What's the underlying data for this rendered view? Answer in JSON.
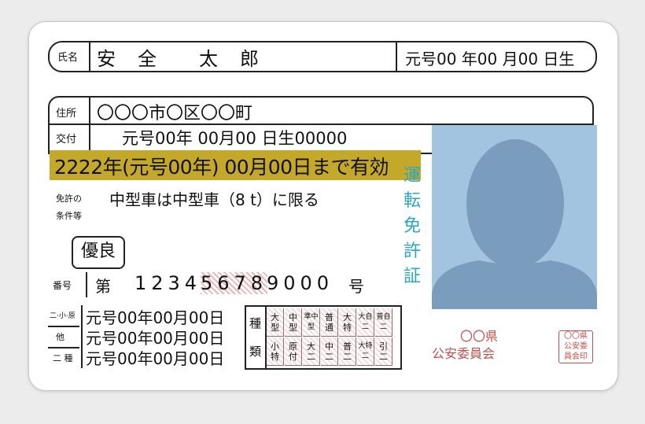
{
  "name": {
    "label": "氏名",
    "value": "安　全　　太　郎",
    "birth": "元号00 年00 月00 日生"
  },
  "address": {
    "label": "住所",
    "value": "〇〇〇市〇区〇〇町"
  },
  "issue": {
    "label": "交付",
    "value": "元号00年 00月00 日生00000"
  },
  "valid_until": "2222年(元号00年) 00月00日まで有効",
  "conditions": {
    "label1": "免許の",
    "label2": "条件等",
    "value": "中型車は中型車（8 t）に限る"
  },
  "excellent": "優良",
  "license_number": {
    "label": "番号",
    "prefix": "第",
    "digits_a": "1234",
    "digits_b": "5678",
    "digits_c": "9000",
    "suffix": "号"
  },
  "dates": {
    "rows": [
      {
        "label": "二·小·原",
        "value": "元号00年00月00日"
      },
      {
        "label": "他",
        "value": "元号00年00月00日"
      },
      {
        "label": "二 種",
        "value": "元号00年00月00日"
      }
    ]
  },
  "kind": {
    "label_top": "種",
    "label_bottom": "類",
    "top_row": [
      "大型",
      "中型",
      "準中型",
      "普通",
      "大特",
      "大自二",
      "普自二"
    ],
    "bottom_row": [
      "小特",
      "原付",
      "大二",
      "中二",
      "普二",
      "大特二",
      "引二"
    ]
  },
  "card_title": [
    "運",
    "転",
    "免",
    "許",
    "証"
  ],
  "issuer": {
    "line1": "〇〇県",
    "line2": "公安委員会"
  },
  "seal": {
    "line1": "〇〇県",
    "line2": "公安委",
    "line3": "員会印"
  },
  "colors": {
    "banner": "#c4a82a",
    "photo_bg": "#a3c4e1",
    "silhouette": "#7b9dbd",
    "title": "#2aa6c2",
    "issuer": "#c0504d"
  }
}
